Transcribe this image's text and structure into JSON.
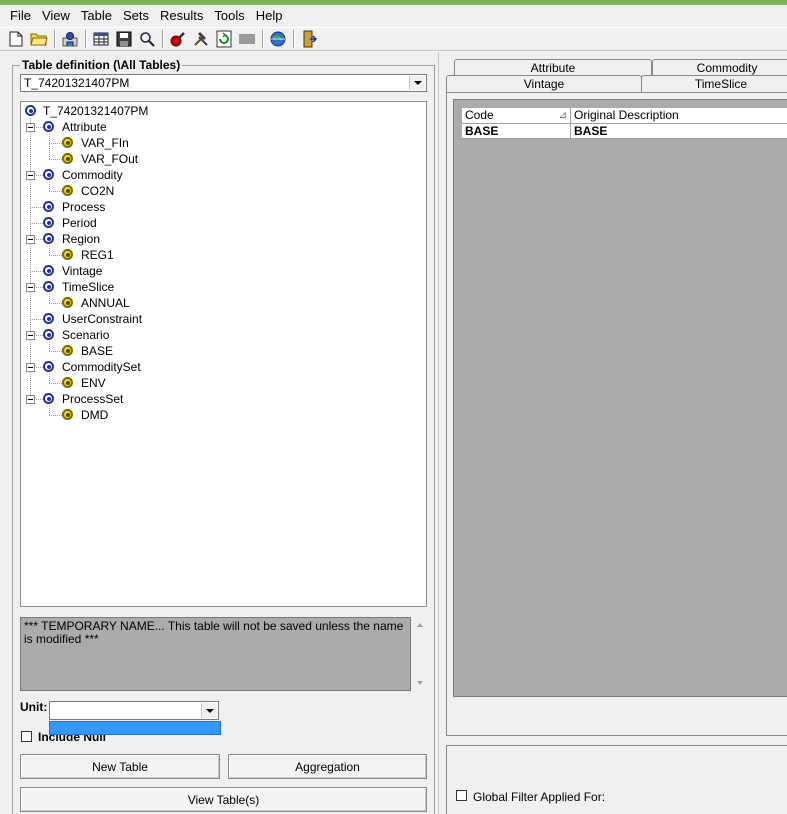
{
  "menu": [
    "File",
    "View",
    "Table",
    "Sets",
    "Results",
    "Tools",
    "Help"
  ],
  "toolbar": {
    "icons": [
      "new-file-icon",
      "open-folder-icon",
      "user-icon",
      "table-grid-icon",
      "save-icon",
      "search-icon",
      "tool-icon",
      "hammer-icon",
      "refresh-icon",
      "disabled-icon",
      "globe-icon",
      "exit-icon"
    ]
  },
  "left": {
    "group_title": "Table definition (\\All Tables)",
    "table_name": "T_74201321407PM",
    "tree": {
      "root": "T_74201321407PM",
      "nodes": [
        {
          "label": "Attribute",
          "children": [
            "VAR_FIn",
            "VAR_FOut"
          ]
        },
        {
          "label": "Commodity",
          "children": [
            "CO2N"
          ]
        },
        {
          "label": "Process",
          "children": []
        },
        {
          "label": "Period",
          "children": []
        },
        {
          "label": "Region",
          "children": [
            "REG1"
          ]
        },
        {
          "label": "Vintage",
          "children": []
        },
        {
          "label": "TimeSlice",
          "children": [
            "ANNUAL"
          ]
        },
        {
          "label": "UserConstraint",
          "children": []
        },
        {
          "label": "Scenario",
          "children": [
            "BASE"
          ]
        },
        {
          "label": "CommoditySet",
          "children": [
            "ENV"
          ]
        },
        {
          "label": "ProcessSet",
          "children": [
            "DMD"
          ]
        }
      ]
    },
    "message": "*** TEMPORARY NAME... This table will not be saved unless the name is modified ***",
    "unit_label": "Unit:",
    "unit_value": "",
    "include_null_label": "Include Null",
    "new_table_label": "New Table",
    "aggregation_label": "Aggregation",
    "view_table_label": "View Table(s)"
  },
  "right": {
    "tabs_row1": [
      "Attribute",
      "Commodity"
    ],
    "tabs_row2": [
      "Vintage",
      "TimeSlice"
    ],
    "grid": {
      "columns": [
        "Code",
        "Original Description"
      ],
      "rows": [
        [
          "BASE",
          "BASE"
        ]
      ]
    },
    "global_filter_label": "Global Filter Applied For:"
  }
}
